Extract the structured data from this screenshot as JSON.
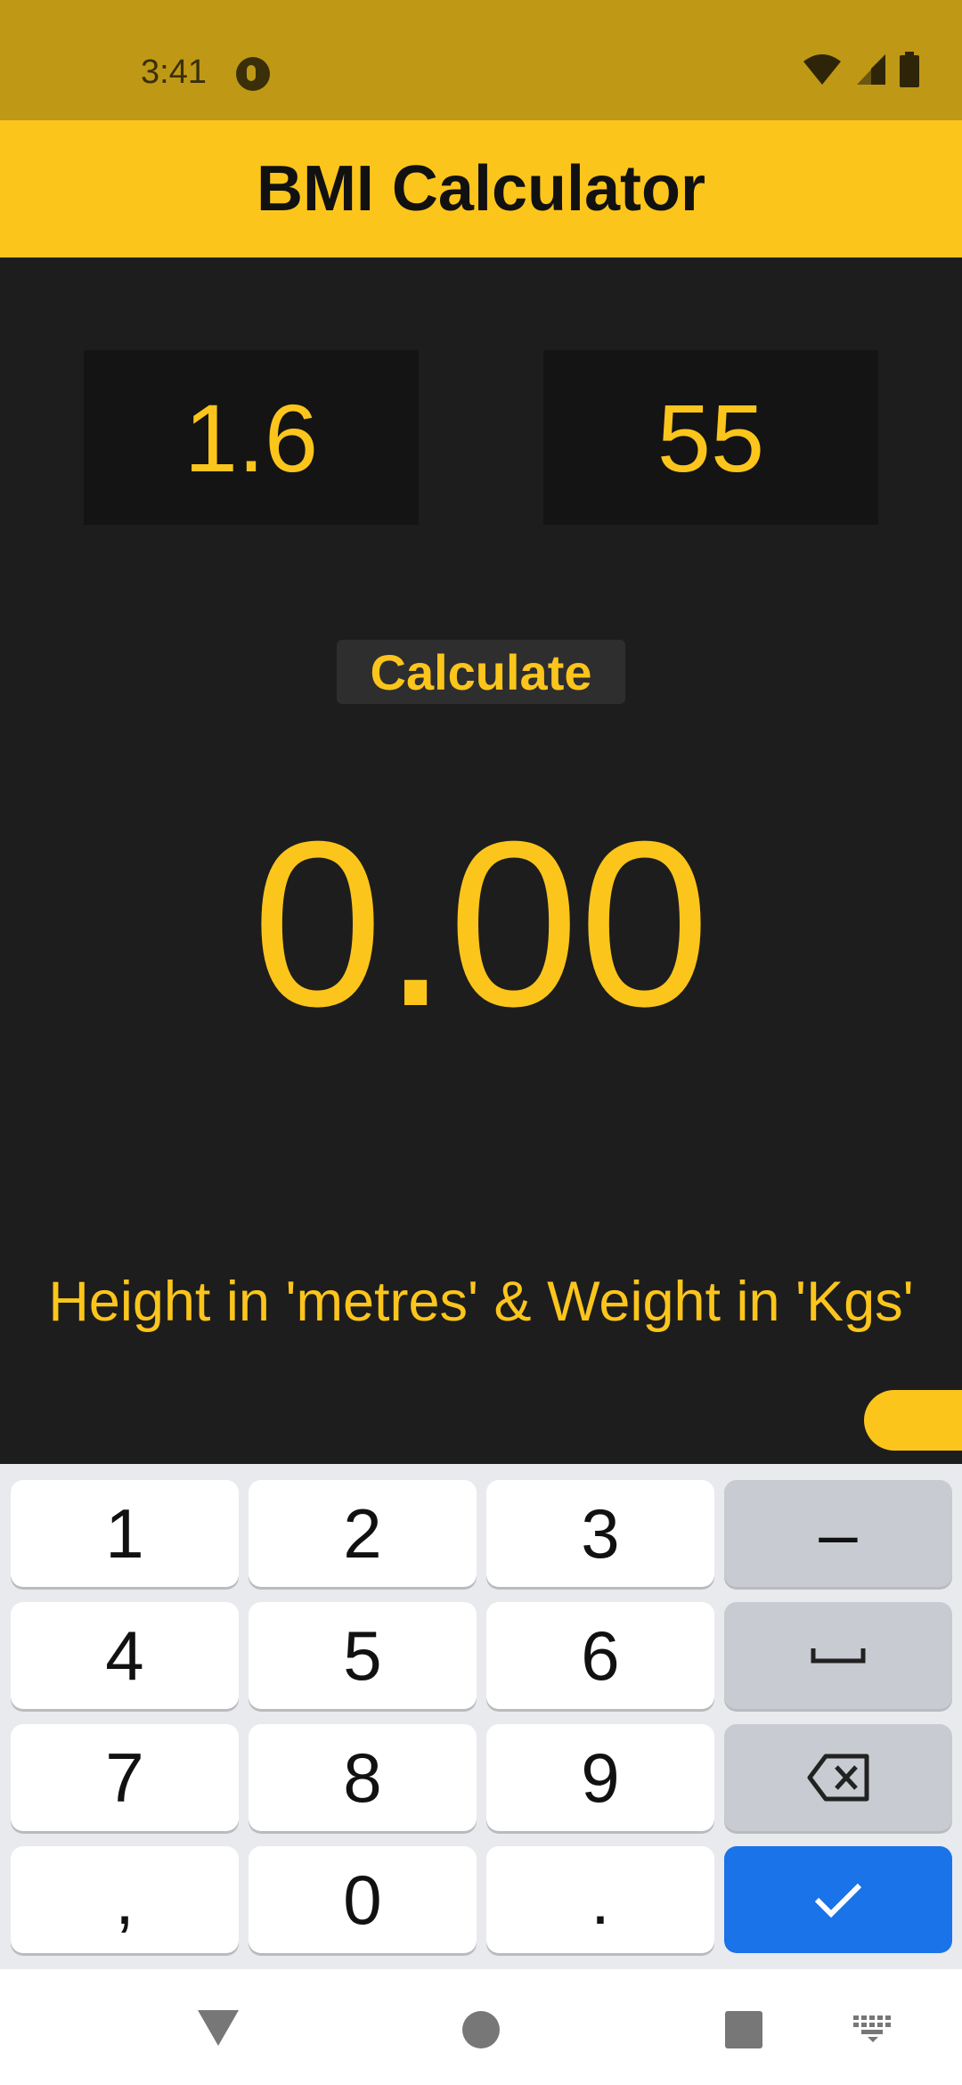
{
  "status_bar": {
    "time": "3:41",
    "icons": [
      "app-notification-icon",
      "wifi-icon",
      "signal-icon",
      "battery-icon"
    ]
  },
  "app_bar": {
    "title": "BMI Calculator"
  },
  "inputs": {
    "height_value": "1.6",
    "weight_value": "55"
  },
  "calculate_button": {
    "label": "Calculate"
  },
  "result": {
    "value": "0.00"
  },
  "hint": {
    "text": "Height in 'metres' & Weight in 'Kgs'"
  },
  "keyboard": {
    "keys": [
      "1",
      "2",
      "3",
      "–",
      "4",
      "5",
      "6",
      "␣",
      "7",
      "8",
      "9",
      "⌫",
      ",",
      "0",
      ".",
      "✓"
    ],
    "row1": {
      "k1": "1",
      "k2": "2",
      "k3": "3",
      "k4": "–"
    },
    "row2": {
      "k1": "4",
      "k2": "5",
      "k3": "6"
    },
    "row3": {
      "k1": "7",
      "k2": "8",
      "k3": "9"
    },
    "row4": {
      "k1": ",",
      "k2": "0",
      "k3": "."
    }
  },
  "nav_bar": {
    "icons": [
      "back-icon",
      "home-icon",
      "recents-icon",
      "keyboard-switch-icon"
    ]
  },
  "colors": {
    "status_bar": "#bf9815",
    "app_bar": "#fcc51c",
    "background": "#1d1d1d",
    "accent": "#fcc51c",
    "input_bg": "#141414",
    "done_key": "#1a73e8"
  }
}
